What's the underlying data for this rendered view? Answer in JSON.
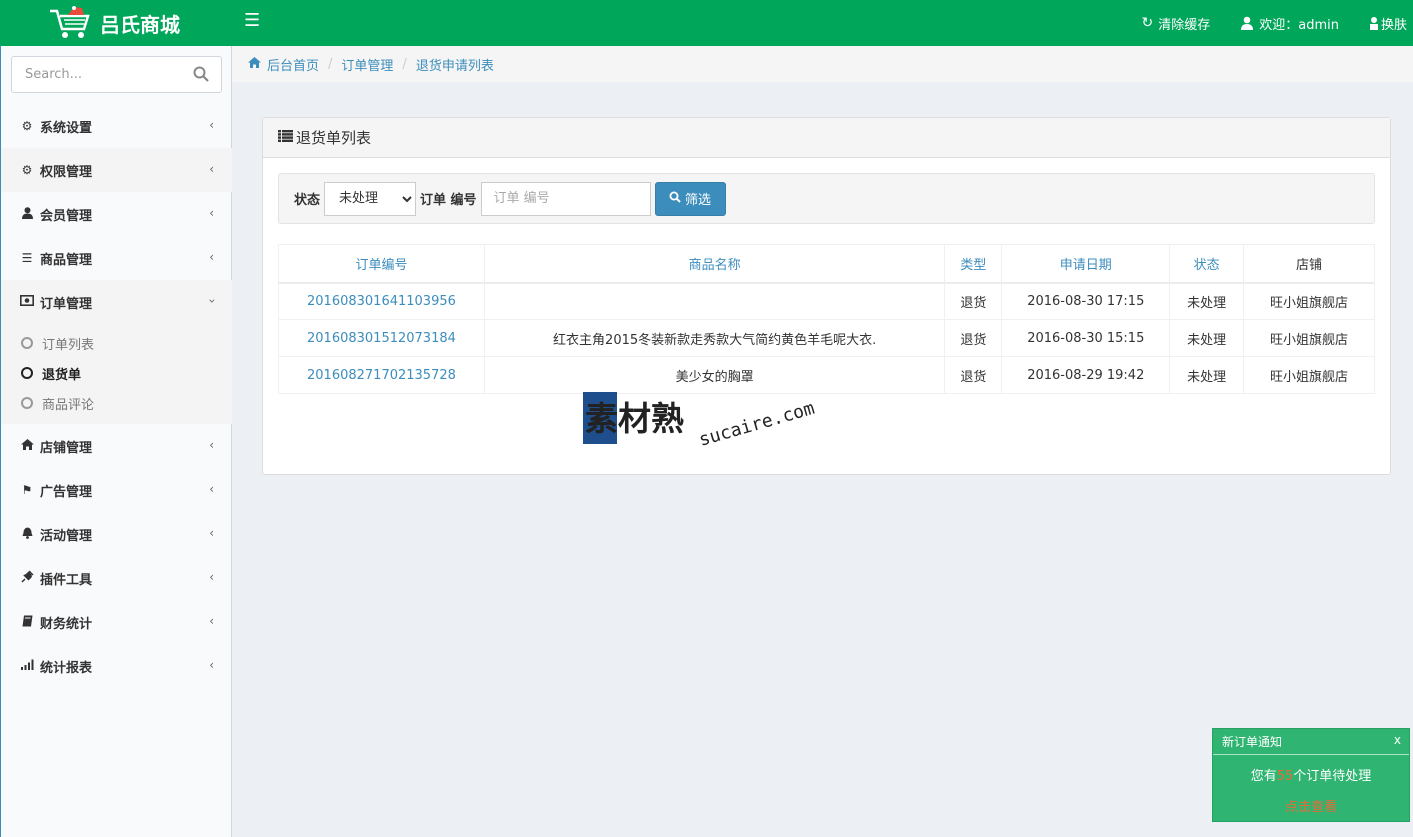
{
  "colors": {
    "brand_green": "#00a65a",
    "link_blue": "#3c8dbc",
    "notify_green": "#2fb571",
    "notify_accent": "#e86b36"
  },
  "header": {
    "title": "吕氏商城",
    "menu_icon": "hamburger-icon",
    "clear_cache": "清除缓存",
    "welcome": "欢迎：admin",
    "skin": "换肤"
  },
  "sidebar": {
    "search_placeholder": "Search...",
    "items": [
      {
        "label": "系统设置",
        "icon": "gear-icon"
      },
      {
        "label": "权限管理",
        "icon": "gears-icon"
      },
      {
        "label": "会员管理",
        "icon": "user-icon"
      },
      {
        "label": "商品管理",
        "icon": "list-icon"
      },
      {
        "label": "订单管理",
        "icon": "money-icon"
      },
      {
        "label": "店铺管理",
        "icon": "home-icon"
      },
      {
        "label": "广告管理",
        "icon": "flag-icon"
      },
      {
        "label": "活动管理",
        "icon": "bell-icon"
      },
      {
        "label": "插件工具",
        "icon": "plug-icon"
      },
      {
        "label": "财务统计",
        "icon": "book-icon"
      },
      {
        "label": "统计报表",
        "icon": "signal-icon"
      }
    ],
    "order_sub": [
      {
        "label": "订单列表"
      },
      {
        "label": "退货单"
      },
      {
        "label": "商品评论"
      }
    ]
  },
  "breadcrumb": {
    "home": "后台首页",
    "level2": "订单管理",
    "level3": "退货申请列表"
  },
  "panel": {
    "title": "退货单列表",
    "filter": {
      "status_label": "状态",
      "status_value": "未处理",
      "order_label": "订单 编号",
      "order_placeholder": "订单 编号",
      "button": "筛选"
    },
    "columns": [
      "订单编号",
      "商品名称",
      "类型",
      "申请日期",
      "状态",
      "店铺"
    ],
    "rows": [
      {
        "order_no": "201608301641103956",
        "product": "",
        "type": "退货",
        "date": "2016-08-30 17:15",
        "status": "未处理",
        "shop": "旺小姐旗舰店"
      },
      {
        "order_no": "201608301512073184",
        "product": "红衣主角2015冬装新款走秀款大气简约黄色羊毛呢大衣.",
        "type": "退货",
        "date": "2016-08-30 15:15",
        "status": "未处理",
        "shop": "旺小姐旗舰店"
      },
      {
        "order_no": "201608271702135728",
        "product": "美少女的胸罩",
        "type": "退货",
        "date": "2016-08-29 19:42",
        "status": "未处理",
        "shop": "旺小姐旗舰店"
      }
    ]
  },
  "watermark": {
    "cn": "素材熟",
    "en": "sucaire.com"
  },
  "notification": {
    "title": "新订单通知",
    "close": "x",
    "prefix": "您有",
    "count": "55",
    "suffix": "个订单待处理",
    "link": "点击查看"
  }
}
